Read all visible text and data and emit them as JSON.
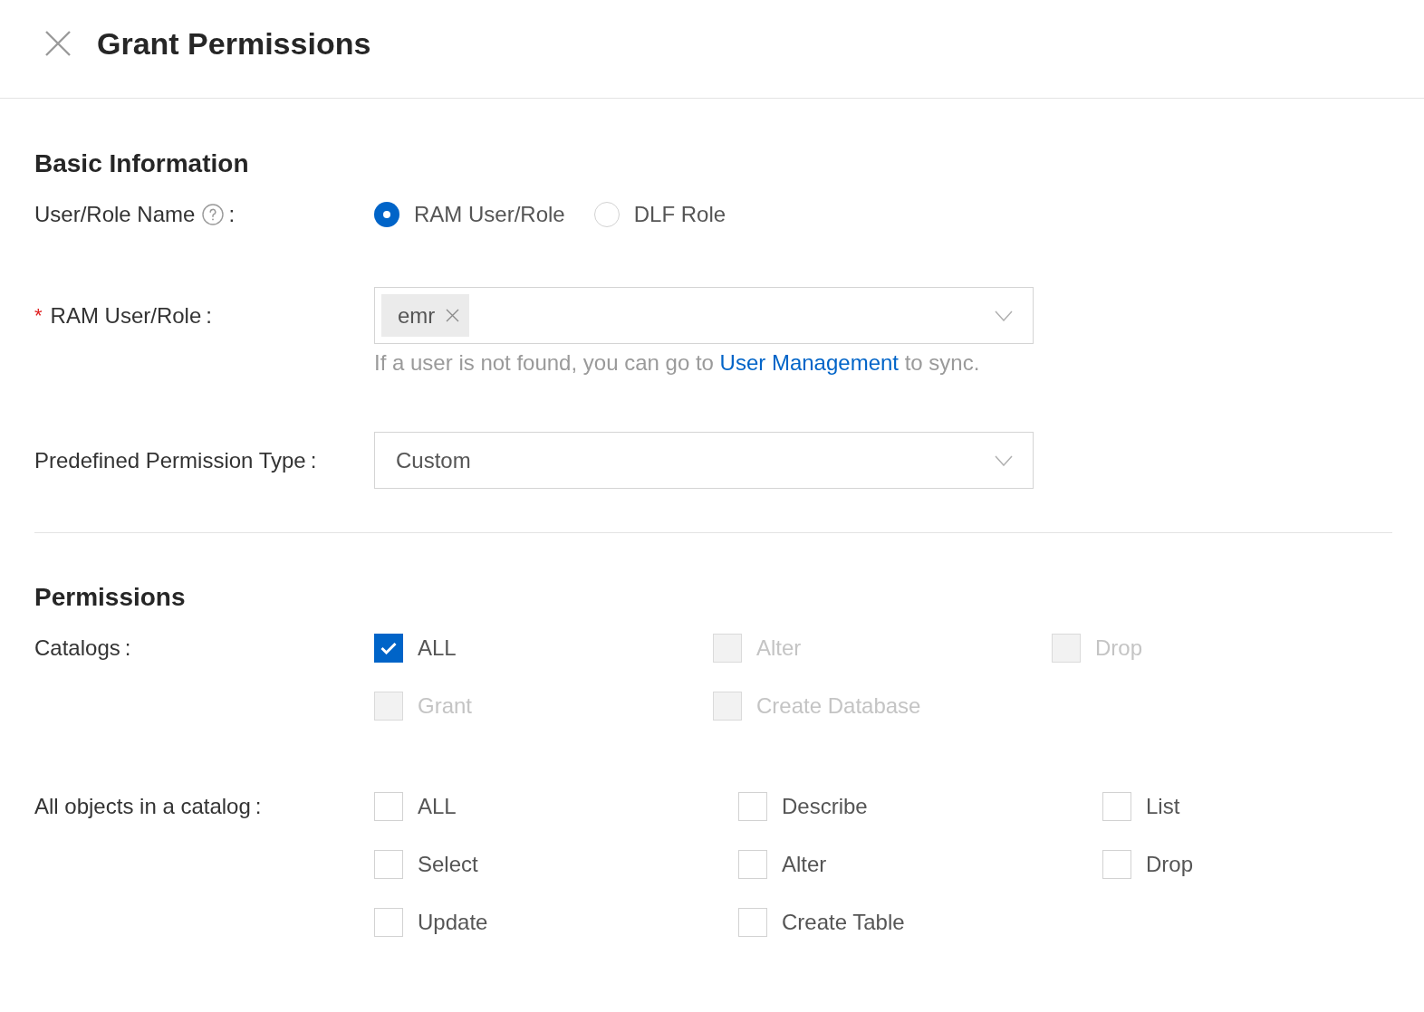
{
  "header": {
    "title": "Grant Permissions"
  },
  "sections": [
    {
      "title": "Basic Information",
      "fields": [
        {
          "kind": "radio",
          "label": "User/Role Name",
          "help": true,
          "colon": ":",
          "options": [
            {
              "label": "RAM User/Role",
              "selected": true
            },
            {
              "label": "DLF Role",
              "selected": false
            }
          ]
        },
        {
          "kind": "tag_select",
          "required_mark": "*",
          "label": "RAM User/Role",
          "colon": ":",
          "tags": [
            "emr"
          ],
          "hint": {
            "before": "If a user is not found, you can go to ",
            "link": "User Management",
            "after": " to sync."
          }
        },
        {
          "kind": "select",
          "label": "Predefined Permission Type",
          "colon": ":",
          "value": "Custom"
        }
      ]
    },
    {
      "title": "Permissions",
      "fields": [
        {
          "kind": "checkboxes",
          "label": "Catalogs",
          "colon": ":",
          "options": [
            {
              "label": "ALL",
              "checked": true,
              "disabled": false
            },
            {
              "label": "Alter",
              "checked": false,
              "disabled": true
            },
            {
              "label": "Drop",
              "checked": false,
              "disabled": true
            },
            {
              "label": "Grant",
              "checked": false,
              "disabled": true
            },
            {
              "label": "Create Database",
              "checked": false,
              "disabled": true
            }
          ]
        },
        {
          "kind": "checkboxes",
          "label": "All objects in a catalog",
          "colon": ":",
          "options": [
            {
              "label": "ALL",
              "checked": false,
              "disabled": false
            },
            {
              "label": "Describe",
              "checked": false,
              "disabled": false
            },
            {
              "label": "List",
              "checked": false,
              "disabled": false
            },
            {
              "label": "Select",
              "checked": false,
              "disabled": false
            },
            {
              "label": "Alter",
              "checked": false,
              "disabled": false
            },
            {
              "label": "Drop",
              "checked": false,
              "disabled": false
            },
            {
              "label": "Update",
              "checked": false,
              "disabled": false
            },
            {
              "label": "Create Table",
              "checked": false,
              "disabled": false
            }
          ]
        }
      ]
    }
  ]
}
